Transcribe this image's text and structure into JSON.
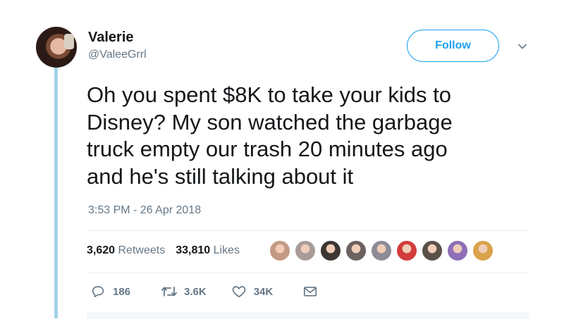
{
  "user": {
    "display_name": "Valerie",
    "handle": "@ValeeGrrl"
  },
  "follow_label": "Follow",
  "tweet": {
    "text": "Oh you spent $8K to take your kids to\nDisney? My son watched the garbage\ntruck empty our trash 20 minutes ago\nand he's still talking about it",
    "timestamp": "3:53 PM - 26 Apr 2018"
  },
  "stats": {
    "retweets_count": "3,620",
    "retweets_label": "Retweets",
    "likes_count": "33,810",
    "likes_label": "Likes"
  },
  "liker_colors": [
    "#c49a84",
    "#a89b98",
    "#3c3533",
    "#6b625f",
    "#8c8c96",
    "#d23c3c",
    "#5a5048",
    "#8e6fb8",
    "#d9a24b"
  ],
  "actions": {
    "reply_count": "186",
    "retweet_count": "3.6K",
    "like_count": "34K"
  },
  "colors": {
    "accent": "#1da1f2",
    "muted": "#657786",
    "text": "#14171a",
    "thread_line": "#a3d2e8"
  },
  "icons": [
    "chevron-down-icon",
    "reply-icon",
    "retweet-icon",
    "heart-icon",
    "envelope-icon"
  ]
}
